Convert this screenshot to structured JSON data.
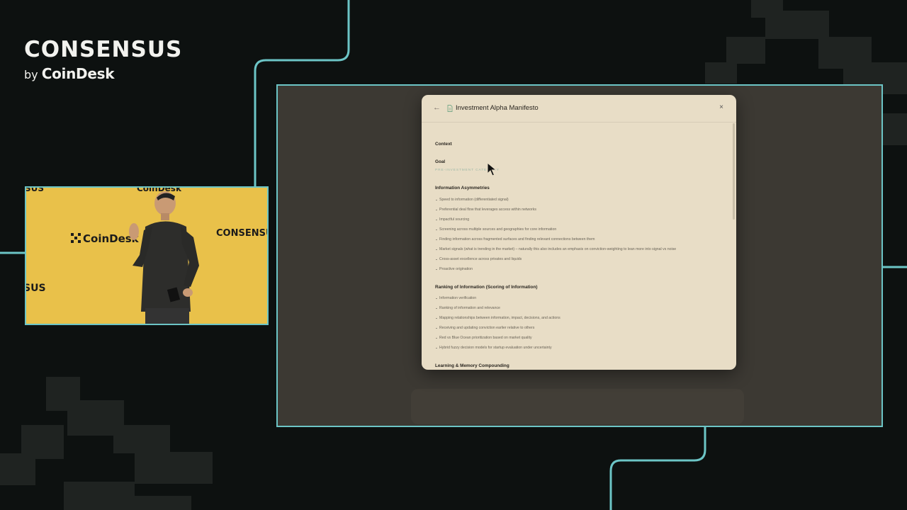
{
  "brand": {
    "name": "CONSENSUS",
    "by": "by",
    "sponsor": "CoinDesk"
  },
  "video": {
    "wall_texts": [
      "CoinDesk",
      "CONSENSU",
      "SUS",
      "SUS",
      "CoinDesk"
    ]
  },
  "modal": {
    "title": "Investment Alpha Manifesto",
    "back": "←",
    "close": "×",
    "sections": {
      "context": "Context",
      "goal": "Goal",
      "goal_subtitle": "PRE-INVESTMENT CATEGORY",
      "info_asym": "Information Asymmetries",
      "ranking": "Ranking of Information (Scoring of Information)",
      "learning": "Learning & Memory Compounding"
    },
    "info_asym_items": [
      "Speed to information (differentiated signal)",
      "Preferential deal flow that leverages access within networks",
      "Impactful sourcing",
      "Screening across multiple sources and geographies for core information",
      "Finding information across fragmented surfaces and finding relevant connections between them",
      "Market signals (what is trending in the market) – naturally this also includes an emphasis on conviction-weighting to lean more into signal vs noise",
      "Cross-asset excellence across privates and liquids",
      "Proactive origination"
    ],
    "ranking_items": [
      "Information verification",
      "Ranking of information and relevance",
      "Mapping relationships between information, impact, decisions, and actions",
      "Receiving and updating conviction earlier relative to others",
      "Red vs Blue Ocean prioritization based on market quality",
      "Hybrid fuzzy decision models for startup evaluation under uncertainty"
    ]
  },
  "colors": {
    "accent_frame": "#6cc5c6",
    "background": "#0d1110",
    "video_wall": "#e9c14a",
    "modal_bg": "#e8ddc6"
  }
}
